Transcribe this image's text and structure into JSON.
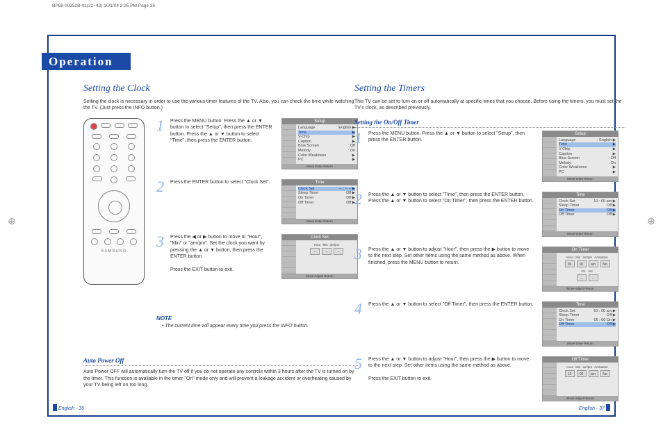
{
  "header_strip": "BP68-00352B-01(22~43)  10/1/04  2:25 PM  Page 36",
  "chapter": "Operation",
  "left": {
    "title": "Setting the Clock",
    "intro": "Setting the clock is necessary in order to use the various timer features of the TV. Also, you can check the time while watching the TV. (Just press the INFO button.)",
    "remote_brand": "SAMSUNG",
    "steps": [
      {
        "num": "1",
        "text": "Press the MENU button. Press the ▲ or ▼ button to select \"Setup\", then press the ENTER button. Press the ▲ or ▼ button to select \"Time\", then press the ENTER button.",
        "osd": {
          "title": "Setup",
          "rows": [
            [
              "Language",
              ": English ▶"
            ],
            [
              "Time",
              "▶"
            ],
            [
              "V-Chip",
              "▶"
            ],
            [
              "Caption",
              "▶"
            ],
            [
              "Blue Screen",
              ": Off"
            ],
            [
              "Melody",
              ": On"
            ],
            [
              "Color Weakness",
              "▶"
            ],
            [
              "PC",
              "▶"
            ]
          ],
          "hl": 1,
          "foot": "Move    Enter    Return"
        }
      },
      {
        "num": "2",
        "text": "Press the ENTER button to select \"Clock Set\".",
        "osd": {
          "title": "Time",
          "rows": [
            [
              "Clock Set",
              "-- : --  -- ▶"
            ],
            [
              "Sleep Timer",
              "Off ▶"
            ],
            [
              "On Timer",
              "Off ▶"
            ],
            [
              "Off Timer",
              "Off ▶"
            ]
          ],
          "hl": 0,
          "foot": "Move    Enter    Return"
        }
      },
      {
        "num": "3",
        "text": "Press the ◀ or ▶ button to move to \"Hour\", \"Min\" or \"am/pm\". Set the clock you want by pressing the ▲ or ▼ button, then press the ENTER button.\n\nPress the EXIT button to exit.",
        "osd": {
          "title": "Clock Set",
          "clock": {
            "labels": [
              "Hour",
              "Min",
              "am/pm"
            ],
            "cells": [
              "--",
              "--",
              "--"
            ]
          },
          "foot": "Move    Adjust    Return"
        }
      }
    ],
    "note_label": "NOTE",
    "note_text": "• The current time will appear every time you press the INFO button.",
    "auto_power_title": "Auto Power Off",
    "auto_power_body": "Auto Power OFF will automatically turn the TV off if you do not operate any controls within 3 hours after the TV is turned on by the timer. This function is available in the timer \"On\" mode only and will prevent a leakage accident or overheating caused by your TV being left on too long."
  },
  "right": {
    "title": "Setting the Timers",
    "intro": "This TV can be set to turn on or off automatically at specific times that you choose. Before using the timers, you must set the TV's clock, as described previously.",
    "sub_title": "Setting the On/Off Timer",
    "steps": [
      {
        "num": "1",
        "text": "Press the MENU button. Press the ▲ or ▼ button to select \"Setup\", then press the ENTER button.",
        "osd": {
          "title": "Setup",
          "rows": [
            [
              "Language",
              ": English ▶"
            ],
            [
              "Time",
              "▶"
            ],
            [
              "V-Chip",
              "▶"
            ],
            [
              "Caption",
              "▶"
            ],
            [
              "Blue Screen",
              ": Off"
            ],
            [
              "Melody",
              ": On"
            ],
            [
              "Color Weakness",
              "▶"
            ],
            [
              "PC",
              "▶"
            ]
          ],
          "hl": 1,
          "foot": "Move    Enter    Return"
        }
      },
      {
        "num": "2",
        "text": "Press the ▲ or ▼ button to select \"Time\", then press the ENTER button. Press the ▲ or ▼ button to select \"On Timer\", then press the ENTER button.",
        "osd": {
          "title": "Time",
          "rows": [
            [
              "Clock Set",
              "10 : 00  am ▶"
            ],
            [
              "Sleep Timer",
              "Off ▶"
            ],
            [
              "On Timer",
              "Off ▶"
            ],
            [
              "Off Timer",
              "Off ▶"
            ]
          ],
          "hl": 2,
          "foot": "Move    Enter    Return"
        }
      },
      {
        "num": "3",
        "text": "Press the ▲ or ▼ button to adjust \"Hour\", then press the ▶ button to move to the next step. Set other items using the same method as above. When finished, press the MENU button to return.",
        "osd": {
          "title": "On Timer",
          "clock": {
            "labels": [
              "Hour",
              "Min",
              "am/pm",
              "Activation"
            ],
            "cells": [
              "06",
              "00",
              "am",
              "No"
            ],
            "extra_labels": [
              "Ch.",
              "Vol."
            ],
            "extra_cells": [
              "--",
              "--"
            ]
          },
          "foot": "Move    Adjust    Return"
        }
      },
      {
        "num": "4",
        "text": "Press the ▲ or ▼ button to select \"Off Timer\", then press the ENTER button.",
        "osd": {
          "title": "Time",
          "rows": [
            [
              "Clock Set",
              "10 : 00  am ▶"
            ],
            [
              "Sleep Timer",
              "Off ▶"
            ],
            [
              "On Timer",
              "06 : 00  On ▶"
            ],
            [
              "Off Timer",
              "Off ▶"
            ]
          ],
          "hl": 3,
          "foot": "Move    Enter    Return"
        }
      },
      {
        "num": "5",
        "text": "Press the ▲ or ▼ button to adjust \"Hour\", then press the ▶ button to move to the next step. Set other items using the same method as above.\n\nPress the EXIT button to exit.",
        "osd": {
          "title": "Off Timer",
          "clock": {
            "labels": [
              "Hour",
              "Min",
              "am/pm",
              "Activation"
            ],
            "cells": [
              "12",
              "00",
              "am",
              "No"
            ]
          },
          "foot": "Move    Adjust    Return"
        }
      }
    ]
  },
  "footer_left": "English - 36",
  "footer_right": "English - 37"
}
